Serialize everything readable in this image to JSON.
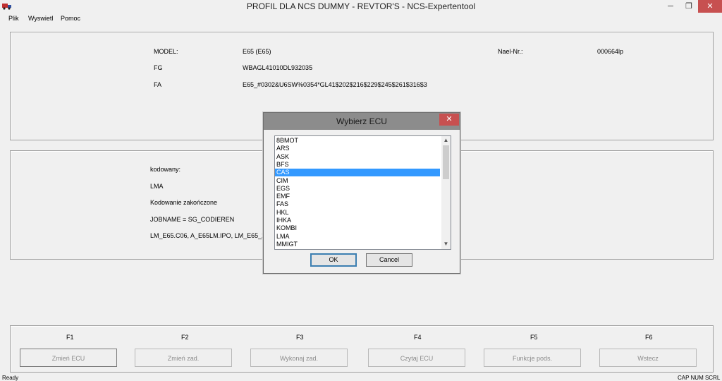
{
  "window": {
    "title": "PROFIL DLA  NCS DUMMY - REVTOR'S - NCS-Expertentool",
    "minimize": "─",
    "maximize": "❐",
    "close": "✕"
  },
  "menu": [
    "Plik",
    "Wyswietl",
    "Pomoc"
  ],
  "vehicle": {
    "model_label": "MODEL:",
    "model_value": "E65 (E65)",
    "fg_label": "FG",
    "fg_value": "WBAGL41010DL932035",
    "fa_label": "FA",
    "fa_value": "E65_#0302&U6SW%0354*GL41$202$216$229$245$261$316$3",
    "nael_label": "Nael-Nr.:",
    "nael_value": "000664lp"
  },
  "status_panel": {
    "line1": "kodowany:",
    "line2": "LMA",
    "line3": "Kodowanie zakończone",
    "line4": "JOBNAME = SG_CODIEREN",
    "line5": "LM_E65.C06, A_E65LM.IPO, LM_E65_2.PRG"
  },
  "function_keys": [
    {
      "key": "F1",
      "label": "Zmień ECU"
    },
    {
      "key": "F2",
      "label": "Zmień zad."
    },
    {
      "key": "F3",
      "label": "Wykonaj zad."
    },
    {
      "key": "F4",
      "label": "Czytaj ECU"
    },
    {
      "key": "F5",
      "label": "Funkcje pods."
    },
    {
      "key": "F6",
      "label": "Wstecz"
    }
  ],
  "statusbar": {
    "left": "Ready",
    "right": "CAP NUM SCRL"
  },
  "dialog": {
    "title": "Wybierz ECU",
    "close": "✕",
    "items": [
      "8BMOT",
      "ARS",
      "ASK",
      "BFS",
      "CAS",
      "CIM",
      "EGS",
      "EMF",
      "FAS",
      "HKL",
      "IHKA",
      "KOMBI",
      "LMA",
      "MMIGT"
    ],
    "selected": "CAS",
    "ok_label": "OK",
    "cancel_label": "Cancel"
  },
  "colors": {
    "selection": "#3399ff",
    "close_button": "#c75050"
  }
}
